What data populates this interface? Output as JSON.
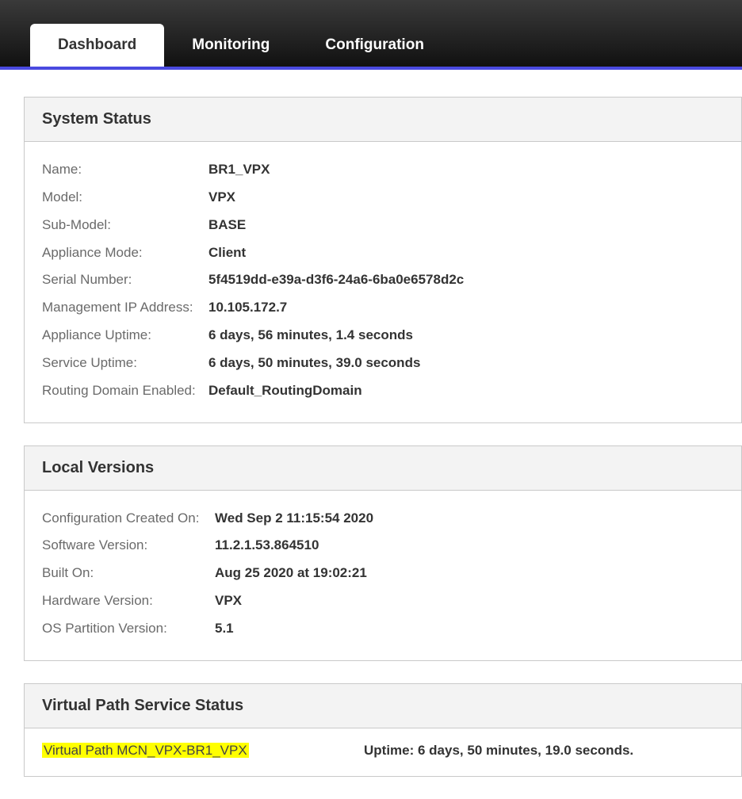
{
  "tabs": {
    "dashboard": "Dashboard",
    "monitoring": "Monitoring",
    "configuration": "Configuration"
  },
  "systemStatus": {
    "title": "System Status",
    "rows": {
      "name": {
        "label": "Name:",
        "value": "BR1_VPX"
      },
      "model": {
        "label": "Model:",
        "value": "VPX"
      },
      "submodel": {
        "label": "Sub-Model:",
        "value": "BASE"
      },
      "mode": {
        "label": "Appliance Mode:",
        "value": "Client"
      },
      "serial": {
        "label": "Serial Number:",
        "value": "5f4519dd-e39a-d3f6-24a6-6ba0e6578d2c"
      },
      "mgmtip": {
        "label": "Management IP Address:",
        "value": "10.105.172.7"
      },
      "auptime": {
        "label": "Appliance Uptime:",
        "value": "6 days, 56 minutes, 1.4 seconds"
      },
      "suptime": {
        "label": "Service Uptime:",
        "value": "6 days, 50 minutes, 39.0 seconds"
      },
      "routing": {
        "label": "Routing Domain Enabled:",
        "value": "Default_RoutingDomain"
      }
    }
  },
  "localVersions": {
    "title": "Local Versions",
    "rows": {
      "cfg": {
        "label": "Configuration Created On:",
        "value": "Wed Sep 2 11:15:54 2020"
      },
      "soft": {
        "label": "Software Version:",
        "value": "11.2.1.53.864510"
      },
      "built": {
        "label": "Built On:",
        "value": "Aug 25 2020 at 19:02:21"
      },
      "hw": {
        "label": "Hardware Version:",
        "value": "VPX"
      },
      "os": {
        "label": "OS Partition Version:",
        "value": "5.1"
      }
    }
  },
  "virtualPath": {
    "title": "Virtual Path Service Status",
    "name": "Virtual Path MCN_VPX-BR1_VPX",
    "uptime": "Uptime: 6 days, 50 minutes, 19.0 seconds."
  }
}
